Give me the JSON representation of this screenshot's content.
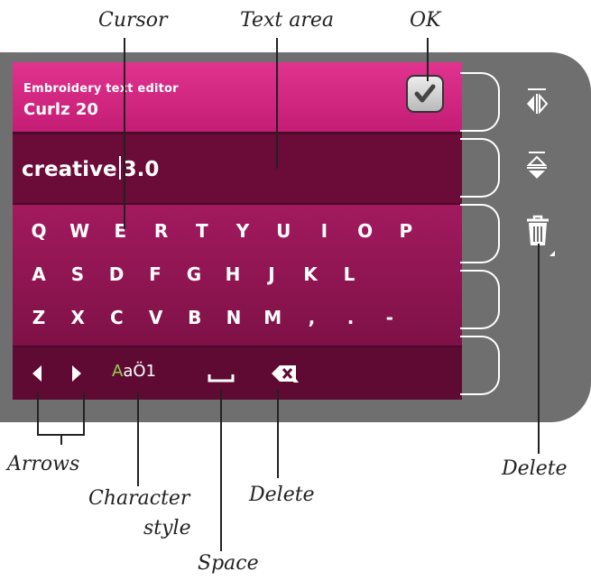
{
  "screen": {
    "editor_title": "Embroidery text editor",
    "font_name": "Curlz 20",
    "text_before_cursor": "creative",
    "text_after_cursor": "3.0"
  },
  "keyboard": {
    "row1": [
      "Q",
      "W",
      "E",
      "R",
      "T",
      "Y",
      "U",
      "I",
      "O",
      "P"
    ],
    "row2": [
      "A",
      "S",
      "D",
      "F",
      "G",
      "H",
      "J",
      "K",
      "L"
    ],
    "row3": [
      "Z",
      "X",
      "C",
      "V",
      "B",
      "N",
      "M",
      ",",
      ".",
      "-"
    ]
  },
  "bottom_bar": {
    "char_style_accent": "A",
    "char_style_rest": "aÖ1"
  },
  "callouts": {
    "cursor": "Cursor",
    "text_area": "Text area",
    "ok": "OK",
    "arrows": "Arrows",
    "character": "Character",
    "style": "style",
    "delete_bottom": "Delete",
    "space": "Space",
    "delete_side": "Delete"
  },
  "colors": {
    "title_bar": "#d42a83",
    "text_row": "#6b0b37",
    "keyboard": "#9a1a5a",
    "bottom_bar": "#5e0a33",
    "bezel": "#6f6f6f",
    "char_style_accent": "#8fd14f"
  },
  "icons": {
    "ok": "checkmark-icon",
    "left_arrow": "arrow-left-icon",
    "right_arrow": "arrow-right-icon",
    "space": "space-icon",
    "backspace": "backspace-icon",
    "mirror_horizontal": "mirror-side-to-side-icon",
    "mirror_vertical": "mirror-end-to-end-icon",
    "trash": "trash-icon"
  }
}
